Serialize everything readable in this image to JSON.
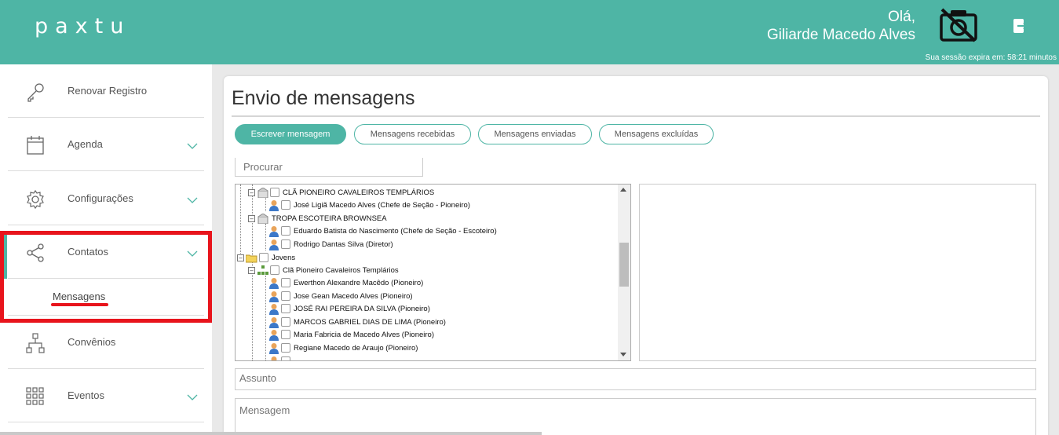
{
  "header": {
    "logo": "paxtu",
    "greeting": "Olá,",
    "user_name": "Giliarde Macedo Alves",
    "session_text": "Sua sessão expira em: 58:21 minutos",
    "brand_color": "#4eb5a5"
  },
  "sidebar": {
    "items": [
      {
        "label": "Renovar  Registro",
        "icon": "key-icon"
      },
      {
        "label": "Agenda",
        "icon": "calendar-icon"
      },
      {
        "label": "Configurações",
        "icon": "gear-icon"
      },
      {
        "label": "Contatos",
        "icon": "share-icon"
      },
      {
        "label": "Convênios",
        "icon": "sitemap-icon"
      },
      {
        "label": "Eventos",
        "icon": "grid-icon"
      }
    ],
    "sub_item": "Mensagens"
  },
  "main": {
    "title": "Envio de mensagens",
    "tabs": [
      "Escrever mensagem",
      "Mensagens recebidas",
      "Mensagens enviadas",
      "Mensagens excluídas"
    ],
    "search_placeholder": "Procurar",
    "tree": [
      "CLÃ PIONEIRO CAVALEIROS TEMPLÁRIOS",
      "José Ligiã Macedo Alves (Chefe de Seção - Pioneiro)",
      "TROPA ESCOTEIRA BROWNSEA",
      "Eduardo Batista do Nascimento (Chefe de Seção - Escoteiro)",
      "Rodrigo Dantas Silva (Diretor)",
      "Jovens",
      "Clã Pioneiro Cavaleiros Templários",
      "Ewerthon Alexandre Macêdo (Pioneiro)",
      "Jose Gean Macedo Alves (Pioneiro)",
      "JOSÉ RAI PEREIRA DA SILVA (Pioneiro)",
      "MARCOS GABRIEL DIAS DE LIMA (Pioneiro)",
      "Maria Fabricia de Macedo Alves (Pioneiro)",
      "Regiane Macedo de Araujo (Pioneiro)"
    ],
    "subject_placeholder": "Assunto",
    "message_placeholder": "Mensagem"
  }
}
